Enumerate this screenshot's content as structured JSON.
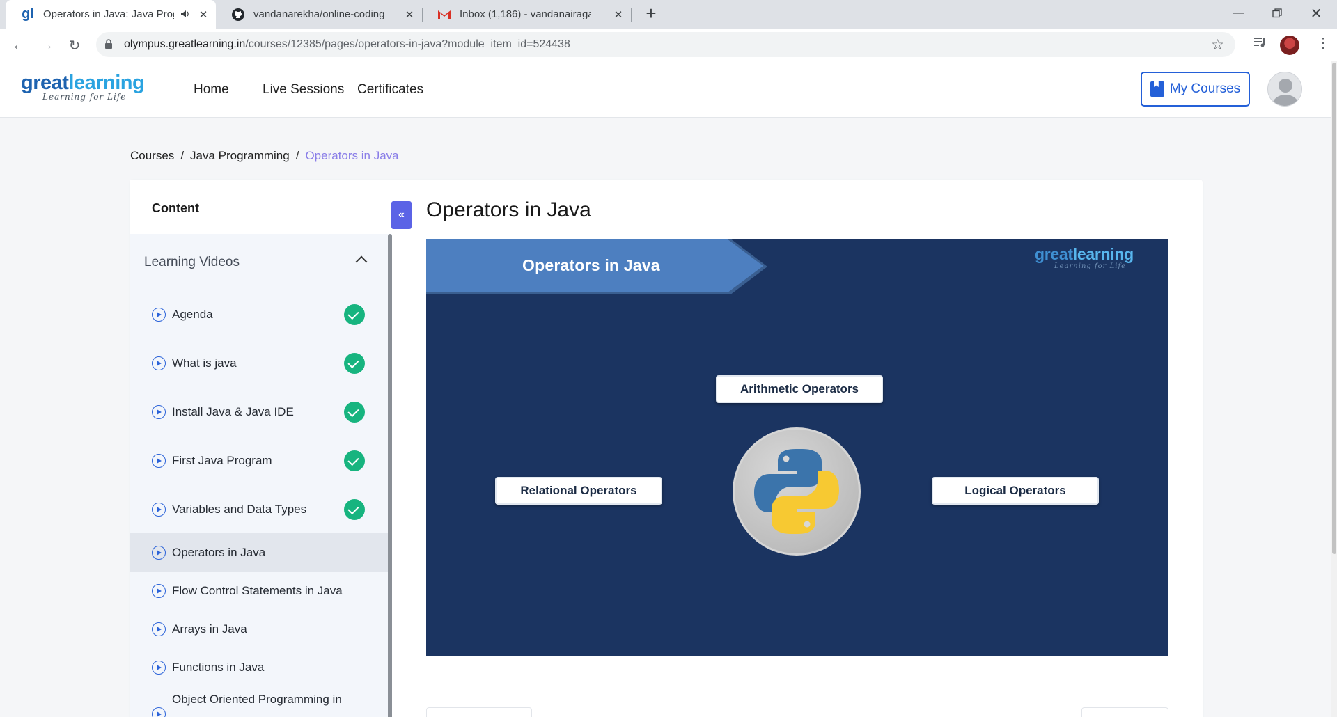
{
  "browser": {
    "tabs": [
      {
        "title": "Operators in Java: Java Progr",
        "active": true
      },
      {
        "title": "vandanarekha/online-coding: LO",
        "active": false
      },
      {
        "title": "Inbox (1,186) - vandanairagar59",
        "active": false
      }
    ],
    "url_domain": "olympus.greatlearning.in",
    "url_path": "/courses/12385/pages/operators-in-java?module_item_id=524438"
  },
  "header": {
    "logo_great": "great",
    "logo_learning": "learning",
    "logo_tagline": "Learning for Life",
    "nav": [
      "Home",
      "Live Sessions",
      "Certificates"
    ],
    "my_courses": "My Courses"
  },
  "breadcrumb": [
    "Courses",
    "Java Programming",
    "Operators in Java"
  ],
  "sidebar": {
    "title": "Content",
    "section": "Learning Videos",
    "items": [
      {
        "label": "Agenda",
        "completed": true
      },
      {
        "label": "What is java",
        "completed": true
      },
      {
        "label": "Install Java & Java IDE",
        "completed": true
      },
      {
        "label": "First Java Program",
        "completed": true
      },
      {
        "label": "Variables and Data Types",
        "completed": true
      },
      {
        "label": "Operators in Java",
        "completed": false,
        "active": true
      },
      {
        "label": "Flow Control Statements in Java",
        "completed": false
      },
      {
        "label": "Arrays in Java",
        "completed": false
      },
      {
        "label": "Functions in Java",
        "completed": false
      },
      {
        "label": "Object Oriented Programming in",
        "completed": false
      }
    ]
  },
  "lesson": {
    "title": "Operators in Java"
  },
  "video": {
    "banner": "Operators in Java",
    "logo_great": "great",
    "logo_learning": "learning",
    "logo_tagline": "Learning for Life",
    "operators": [
      "Arithmetic Operators",
      "Relational Operators",
      "Logical Operators"
    ]
  },
  "colors": {
    "accent": "#2460d8",
    "collapse": "#5b63e6",
    "check": "#17b47f",
    "breadcrumb_current": "#8a7ee8",
    "slide_bg": "#1b3461",
    "slide_banner": "#4d7fc0"
  }
}
